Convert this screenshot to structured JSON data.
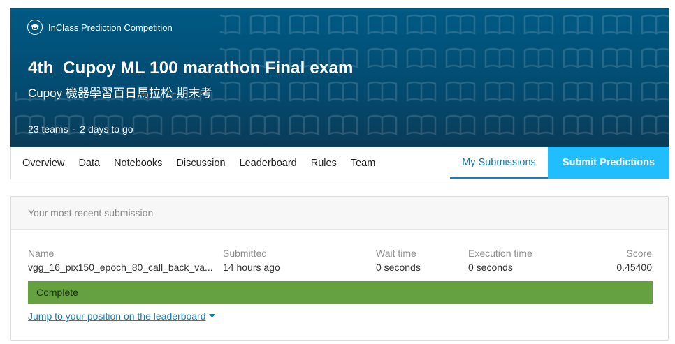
{
  "banner": {
    "competition_type": "InClass Prediction Competition",
    "title": "4th_Cupoy ML 100 marathon Final exam",
    "subtitle": "Cupoy 機器學習百日馬拉松-期末考",
    "teams": "23 teams",
    "separator": "·",
    "time_left": "2 days to go",
    "colors": {
      "background": "#005a84"
    }
  },
  "nav": {
    "tabs": [
      "Overview",
      "Data",
      "Notebooks",
      "Discussion",
      "Leaderboard",
      "Rules",
      "Team"
    ],
    "my_submissions": "My Submissions",
    "submit_button": "Submit Predictions",
    "colors": {
      "active": "#0d78a9",
      "submit_bg": "#20beff"
    }
  },
  "submission": {
    "header": "Your most recent submission",
    "columns": {
      "name": {
        "label": "Name",
        "value": "vgg_16_pix150_epoch_80_call_back_va..."
      },
      "submitted": {
        "label": "Submitted",
        "value": "14 hours ago"
      },
      "wait_time": {
        "label": "Wait time",
        "value": "0 seconds"
      },
      "execution_time": {
        "label": "Execution time",
        "value": "0 seconds"
      },
      "score": {
        "label": "Score",
        "value": "0.45400"
      }
    },
    "status": "Complete",
    "status_color": "#66a141",
    "jump_link": "Jump to your position on the leaderboard"
  }
}
